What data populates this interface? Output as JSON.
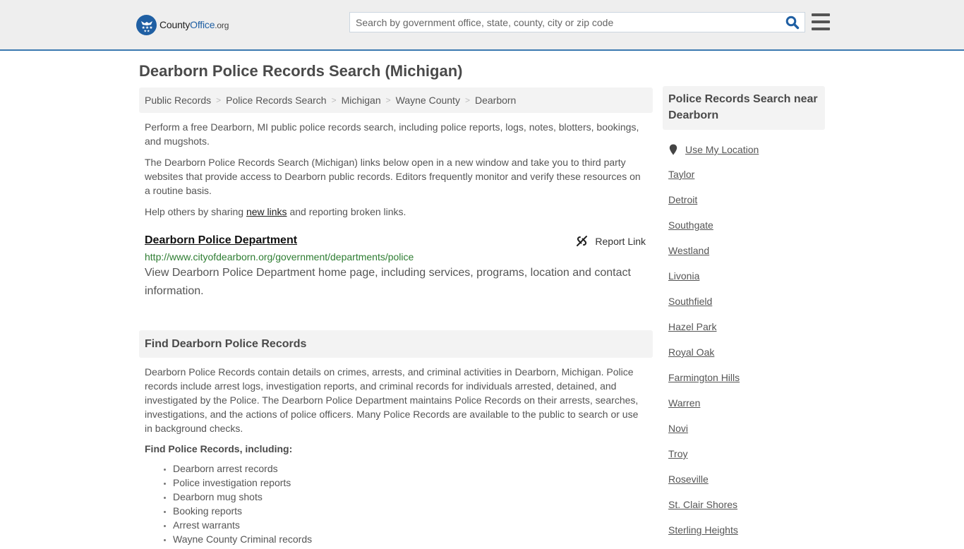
{
  "header": {
    "logo": {
      "name_part1": "County",
      "name_part2": "Office",
      "name_part3": ".org"
    },
    "search": {
      "placeholder": "Search by government office, state, county, city or zip code",
      "value": ""
    },
    "accent_color": "#3b79b0",
    "brand_color": "#1f5fa3"
  },
  "page": {
    "title": "Dearborn Police Records Search (Michigan)"
  },
  "breadcrumb": [
    {
      "label": "Public Records"
    },
    {
      "label": "Police Records Search"
    },
    {
      "label": "Michigan"
    },
    {
      "label": "Wayne County"
    },
    {
      "label": "Dearborn"
    }
  ],
  "breadcrumb_separator": ">",
  "intro": {
    "p1": "Perform a free Dearborn, MI public police records search, including police reports, logs, notes, blotters, bookings, and mugshots.",
    "p2": "The Dearborn Police Records Search (Michigan) links below open in a new window and take you to third party websites that provide access to Dearborn public records. Editors frequently monitor and verify these resources on a routine basis.",
    "p3_before": "Help others by sharing ",
    "p3_link": "new links",
    "p3_after": " and reporting broken links."
  },
  "resources": [
    {
      "title": "Dearborn Police Department",
      "url": "http://www.cityofdearborn.org/government/departments/police",
      "description": "View Dearborn Police Department home page, including services, programs, location and contact information.",
      "report_label": "Report Link"
    }
  ],
  "find_section": {
    "heading": "Find Dearborn Police Records",
    "paragraph": "Dearborn Police Records contain details on crimes, arrests, and criminal activities in Dearborn, Michigan. Police records include arrest logs, investigation reports, and criminal records for individuals arrested, detained, and investigated by the Police. The Dearborn Police Department maintains Police Records on their arrests, searches, investigations, and the actions of police officers. Many Police Records are available to the public to search or use in background checks.",
    "subheading": "Find Police Records, including:",
    "items": [
      "Dearborn arrest records",
      "Police investigation reports",
      "Dearborn mug shots",
      "Booking reports",
      "Arrest warrants",
      "Wayne County Criminal records"
    ]
  },
  "sidebar": {
    "heading": "Police Records Search near Dearborn",
    "use_location": "Use My Location",
    "cities": [
      "Taylor",
      "Detroit",
      "Southgate",
      "Westland",
      "Livonia",
      "Southfield",
      "Hazel Park",
      "Royal Oak",
      "Farmington Hills",
      "Warren",
      "Novi",
      "Troy",
      "Roseville",
      "St. Clair Shores",
      "Sterling Heights"
    ]
  }
}
